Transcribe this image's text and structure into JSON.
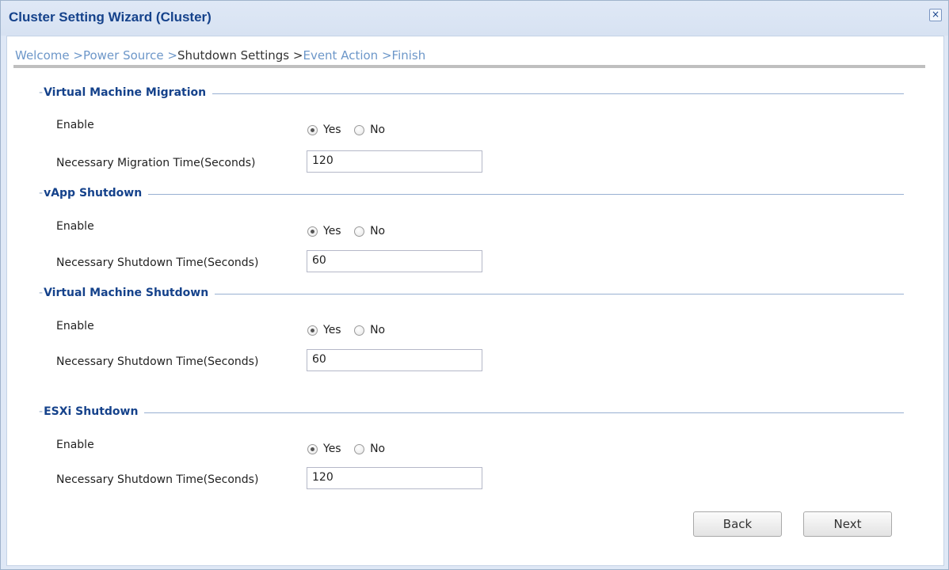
{
  "window": {
    "title": "Cluster Setting Wizard (Cluster)",
    "close_glyph": "×"
  },
  "breadcrumb": {
    "steps": [
      "Welcome >",
      "Power Source >",
      "Shutdown Settings >",
      "Event Action >",
      "Finish"
    ],
    "current_index": 2
  },
  "sections": [
    {
      "legend": "Virtual Machine Migration",
      "enable_label": "Enable",
      "yes": "Yes",
      "no": "No",
      "selected": "Yes",
      "time_label": "Necessary Migration Time(Seconds)",
      "time_value": "120"
    },
    {
      "legend": "vApp Shutdown",
      "enable_label": "Enable",
      "yes": "Yes",
      "no": "No",
      "selected": "Yes",
      "time_label": "Necessary Shutdown Time(Seconds)",
      "time_value": "60"
    },
    {
      "legend": "Virtual Machine Shutdown",
      "enable_label": "Enable",
      "yes": "Yes",
      "no": "No",
      "selected": "Yes",
      "time_label": "Necessary Shutdown Time(Seconds)",
      "time_value": "60"
    },
    {
      "legend": "ESXi Shutdown",
      "enable_label": "Enable",
      "yes": "Yes",
      "no": "No",
      "selected": "Yes",
      "time_label": "Necessary Shutdown Time(Seconds)",
      "time_value": "120"
    }
  ],
  "buttons": {
    "back": "Back",
    "next": "Next"
  },
  "colors": {
    "title": "#15428b",
    "breadcrumb_link": "#6d97c9",
    "frame": "#dfe8f6"
  }
}
